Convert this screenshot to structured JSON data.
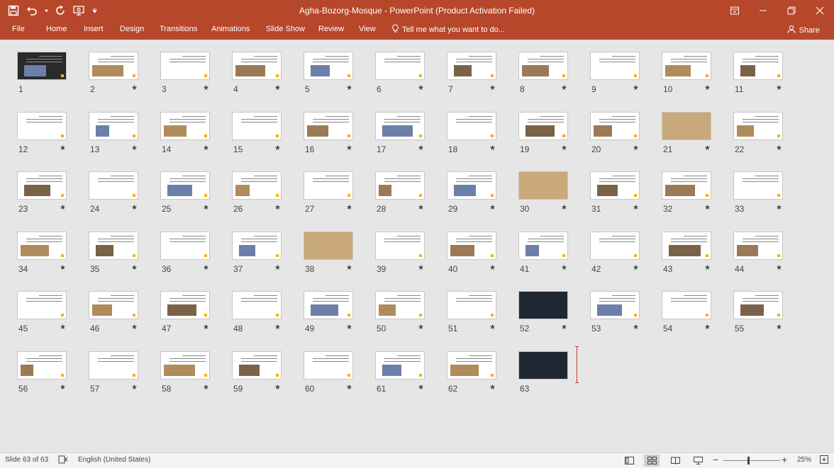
{
  "window": {
    "title": "Agha-Bozorg-Mosque - PowerPoint (Product Activation Failed)"
  },
  "ribbon": {
    "tabs": [
      "File",
      "Home",
      "Insert",
      "Design",
      "Transitions",
      "Animations",
      "Slide Show",
      "Review",
      "View"
    ],
    "tell_me": "Tell me what you want to do...",
    "share": "Share"
  },
  "slides": {
    "count": 63,
    "selected": 63,
    "star": "★"
  },
  "status": {
    "slide_info": "Slide 63 of 63",
    "language": "English (United States)",
    "zoom": "25%",
    "zoom_fraction": 0.25
  },
  "colors": {
    "ribbon": "#b7472a",
    "accent": "#f5b400",
    "cursor": "#c0392b"
  }
}
